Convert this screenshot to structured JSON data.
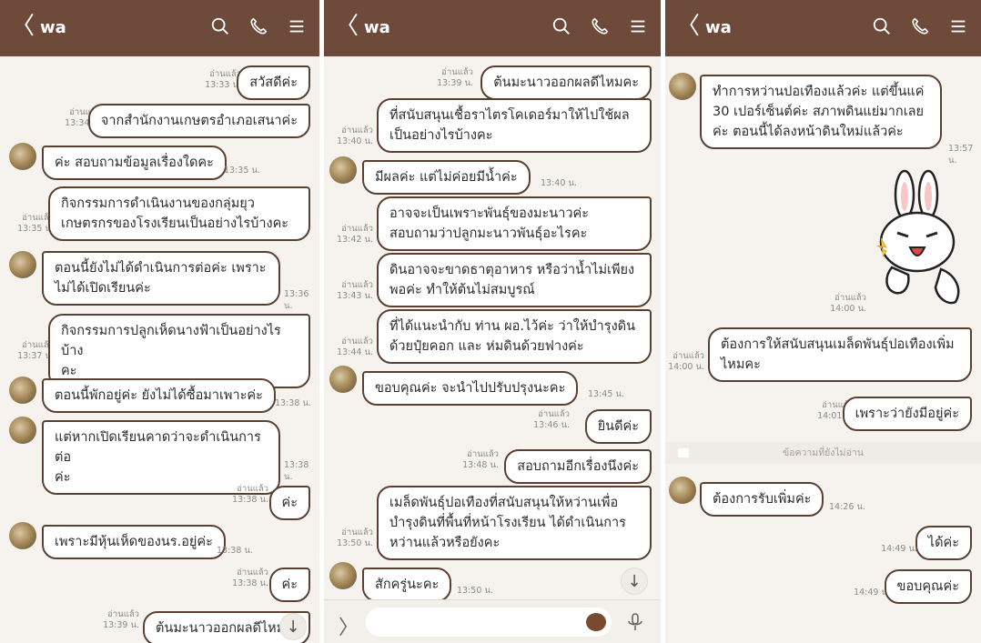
{
  "panels": [
    {
      "title": "wa",
      "messages": [
        {
          "text": "สวัสดีค่ะ",
          "read": "อ่านแล้ว",
          "time": "13:33 น."
        },
        {
          "text": "จากสำนักงานเกษตรอำเภอเสนาค่ะ",
          "read": "อ่านแล้ว",
          "time": "13:34 น."
        },
        {
          "text": "ค่ะ สอบถามข้อมูลเรื่องใดคะ",
          "time": "13:35 น."
        },
        {
          "text": "กิจกรรมการดำเนินงานของกลุ่มยุวเกษตรกรของโรงเรียนเป็นอย่างไรบ้างคะ",
          "line1": "กิจกรรมการดำเนินงานของกลุ่มยุว",
          "line2": "เกษตรกรของโรงเรียนเป็นอย่างไรบ้างคะ",
          "read": "อ่านแล้ว",
          "time": "13:35 น."
        },
        {
          "text": "ตอนนี้ยังไม่ได้ดำเนินการต่อค่ะ เพราะไม่ได้เปิดเรียนค่ะ",
          "line1": "ตอนนี้ยังไม่ได้ดำเนินการต่อค่ะ เพราะ",
          "line2": "ไม่ได้เปิดเรียนค่ะ",
          "time": "13:36 น."
        },
        {
          "text": "กิจกรรมการปลูกเห็ดนางฟ้าเป็นอย่างไรบ้างคะ",
          "line1": "กิจกรรมการปลูกเห็ดนางฟ้าเป็นอย่างไรบ้าง",
          "line2": "คะ",
          "read": "อ่านแล้ว",
          "time": "13:37 น."
        },
        {
          "text": "ตอนนี้พักอยู่ค่ะ ยังไม่ได้ซื้อมาเพาะค่ะ",
          "time": "13:38 น."
        },
        {
          "text": "แต่หากเปิดเรียนคาดว่าจะดำเนินการต่อค่ะ",
          "line1": "แต่หากเปิดเรียนคาดว่าจะดำเนินการต่อ",
          "line2": "ค่ะ",
          "time": "13:38 น."
        },
        {
          "text": "ค่ะ",
          "read": "อ่านแล้ว",
          "time": "13:38 น."
        },
        {
          "text": "เพราะมีหุ้นเห็ดของนร.อยู่ค่ะ",
          "time": "13:38 น."
        },
        {
          "text": "ค่ะ",
          "read": "อ่านแล้ว",
          "time": "13:38 น."
        },
        {
          "text": "ต้นมะนาวออกผลดีไหมค",
          "read": "อ่านแล้ว",
          "time": "13:39 น."
        }
      ]
    },
    {
      "title": "wa",
      "messages": [
        {
          "text": "ต้นมะนาวออกผลดีไหมคะ",
          "read": "อ่านแล้ว",
          "time": "13:39 น."
        },
        {
          "text": "ที่สนับสนุนเชื้อราไตรโคเดอร์มาให้ไปใช้ผลเป็นอย่างไรบ้างคะ",
          "line1": "ที่สนับสนุนเชื้อราไตรโคเดอร์มาให้ไปใช้ผล",
          "line2": "เป็นอย่างไรบ้างคะ",
          "read": "อ่านแล้ว",
          "time": "13:40 น."
        },
        {
          "text": "มีผลค่ะ แต่ไม่ค่อยมีน้ำค่ะ",
          "time": "13:40 น."
        },
        {
          "text": "อาจจะเป็นเพราะพันธุ์ของมะนาวค่ะ สอบถามว่าปลูกมะนาวพันธุ์อะไรคะ",
          "line1": "อาจจะเป็นเพราะพันธุ์ของมะนาวค่ะ",
          "line2": "สอบถามว่าปลูกมะนาวพันธุ์อะไรคะ",
          "read": "อ่านแล้ว",
          "time": "13:42 น."
        },
        {
          "text": "ดินอาจจะขาดธาตุอาหาร หรือว่าน้ำไม่เพียงพอค่ะ ทำให้ต้นไม่สมบูรณ์",
          "line1": "ดินอาจจะขาดธาตุอาหาร หรือว่าน้ำไม่เพียง",
          "line2": "พอค่ะ ทำให้ต้นไม่สมบูรณ์",
          "read": "อ่านแล้ว",
          "time": "13:43 น."
        },
        {
          "text": "ที่ได้แนะนำกับ ท่าน ผอ.ไว้ค่ะ ว่าให้บำรุงดินด้วยปุ๋ยคอก และ ห่มดินด้วยฟางค่ะ",
          "line1": "ที่ได้แนะนำกับ ท่าน ผอ.ไว้ค่ะ ว่าให้บำรุงดิน",
          "line2": "ด้วยปุ๋ยคอก และ ห่มดินด้วยฟางค่ะ",
          "read": "อ่านแล้ว",
          "time": "13:44 น."
        },
        {
          "text": "ขอบคุณค่ะ จะนำไปปรับปรุงนะคะ",
          "time": "13:45 น."
        },
        {
          "text": "ยินดีค่ะ",
          "read": "อ่านแล้ว",
          "time": "13:46 น."
        },
        {
          "text": "สอบถามอีกเรื่องนึงค่ะ",
          "read": "อ่านแล้ว",
          "time": "13:48 น."
        },
        {
          "text": "เมล็ดพันธุ์ปอเทืองที่สนับสนุนให้หว่านเพื่อบำรุงดินที่พื้นที่หน้าโรงเรียน ได้ดำเนินการหว่านแล้วหรือยังคะ",
          "line1": "เมล็ดพันธุ์ปอเทืองที่สนับสนุนให้หว่านเพื่อ",
          "line2": "บำรุงดินที่พื้นที่หน้าโรงเรียน ได้ดำเนินการ",
          "line3": "หว่านแล้วหรือยังคะ",
          "read": "อ่านแล้ว",
          "time": "13:50 น."
        },
        {
          "text": "สักครู่นะคะ",
          "time": "13:50 น."
        }
      ]
    },
    {
      "title": "wa",
      "messages": [
        {
          "text": "ทำการหว่านปอเทืองแล้วค่ะ แต่ขึ้นแค่ 30 เปอร์เซ็นต์ค่ะ สภาพดินแย่มากเลยค่ะ ตอนนี้ได้ลงหน้าดินใหม่แล้วค่ะ",
          "line1": "ทำการหว่านปอเทืองแล้วค่ะ แต่ขึ้นแค่",
          "line2": "30 เปอร์เซ็นต์ค่ะ สภาพดินแย่มากเลย",
          "line3": "ค่ะ ตอนนี้ได้ลงหน้าดินใหม่แล้วค่ะ",
          "time": "13:57 น."
        },
        {
          "sticker": "rabbit-sticker",
          "read": "อ่านแล้ว",
          "time": "14:00 น."
        },
        {
          "text": "ต้องการให้สนับสนุนเมล็ดพันธุ์ปอเทืองเพิ่มไหมคะ",
          "line1": "ต้องการให้สนับสนุนเมล็ดพันธุ์ปอเทืองเพิ่ม",
          "line2": "ไหมคะ",
          "read": "อ่านแล้ว",
          "time": "14:00 น."
        },
        {
          "text": "เพราะว่ายังมีอยู่ค่ะ",
          "read": "อ่านแล้ว",
          "time": "14:01 น."
        },
        {
          "text": "ต้องการรับเพิ่มค่ะ",
          "time": "14:26 น."
        },
        {
          "text": "ได้ค่ะ",
          "time": "14:49 น."
        },
        {
          "text": "ขอบคุณค่ะ",
          "time": "14:49 น."
        }
      ],
      "unread_label": "ข้อความที่ยังไม่อ่าน"
    }
  ],
  "icons": {
    "back": "back-arrow-icon",
    "search": "search-icon",
    "call": "phone-icon",
    "menu": "menu-icon",
    "scroll_down": "arrow-down-icon",
    "expand": "chevron-right-icon",
    "sticker": "sticker-icon",
    "mic": "mic-icon"
  },
  "glyphs": {
    "back": "〈",
    "down": "↓",
    "chevron": "〉"
  },
  "colors": {
    "header": "#6e4a3a",
    "bubble_border": "#5a4030",
    "background": "#f6f3ef"
  }
}
